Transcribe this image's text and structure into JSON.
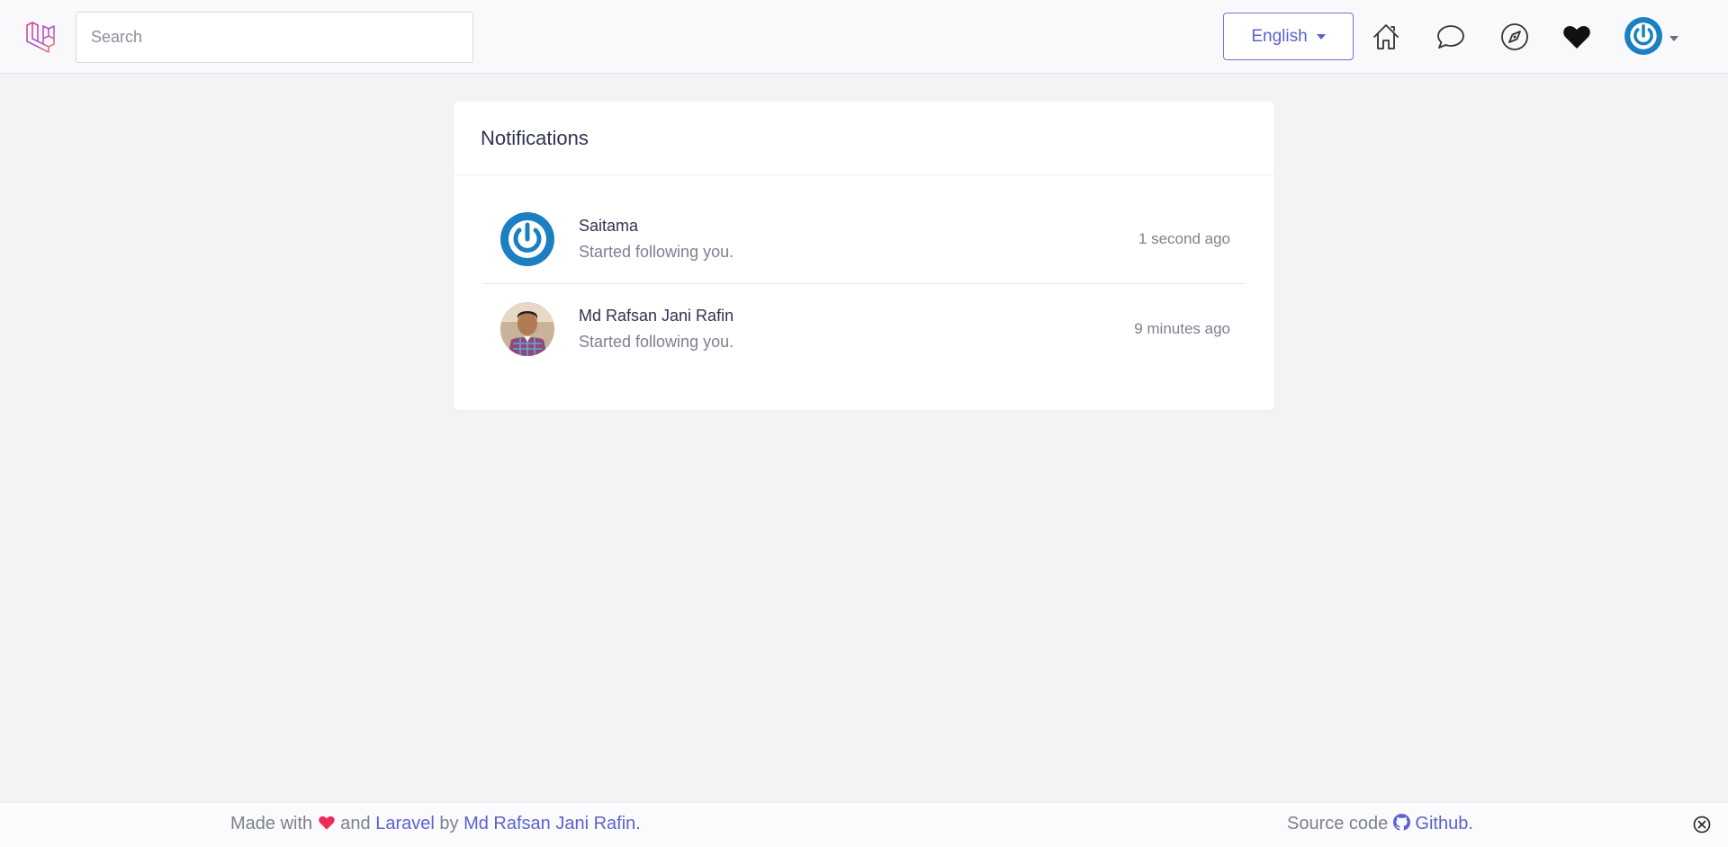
{
  "header": {
    "search_placeholder": "Search",
    "language_label": "English",
    "icons": [
      "laravel-logo-icon",
      "home-icon",
      "chat-icon",
      "compass-icon",
      "heart-icon",
      "user-avatar"
    ]
  },
  "notifications": {
    "title": "Notifications",
    "items": [
      {
        "name": "Saitama",
        "message": "Started following you.",
        "time": "1 second ago"
      },
      {
        "name": "Md Rafsan Jani Rafin",
        "message": "Started following you.",
        "time": "9 minutes ago"
      }
    ]
  },
  "footer": {
    "made_with": "Made with",
    "and": "and",
    "laravel": "Laravel",
    "by": "by",
    "author": "Md Rafsan Jani Rafin",
    "period": ".",
    "source_code": "Source code",
    "github": "Github",
    "period2": "."
  },
  "colors": {
    "accent": "#5a63cf",
    "heart": "#ee2b55",
    "avatar_blue": "#1b7fc1",
    "background": "#f2f3f5"
  }
}
